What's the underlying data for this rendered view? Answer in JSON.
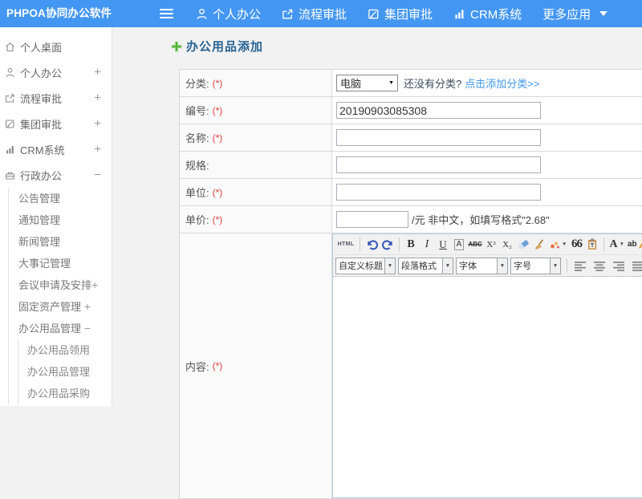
{
  "topbar": {
    "logo": "PHPOA协同办公软件",
    "nav": [
      {
        "label": "个人办公"
      },
      {
        "label": "流程审批"
      },
      {
        "label": "集团审批"
      },
      {
        "label": "CRM系统"
      },
      {
        "label": "更多应用"
      }
    ]
  },
  "sidebar": {
    "items": [
      {
        "label": "个人桌面",
        "expander": ""
      },
      {
        "label": "个人办公",
        "expander": "+"
      },
      {
        "label": "流程审批",
        "expander": "+"
      },
      {
        "label": "集团审批",
        "expander": "+"
      },
      {
        "label": "CRM系统",
        "expander": "+"
      },
      {
        "label": "行政办公",
        "expander": "−"
      }
    ],
    "admin_children": [
      {
        "label": "公告管理",
        "expander": ""
      },
      {
        "label": "通知管理",
        "expander": ""
      },
      {
        "label": "新闻管理",
        "expander": ""
      },
      {
        "label": "大事记管理",
        "expander": ""
      },
      {
        "label": "会议申请及安排",
        "expander": "+"
      },
      {
        "label": "固定资产管理",
        "expander": " +"
      },
      {
        "label": "办公用品管理",
        "expander": " −"
      }
    ],
    "supplies_children": [
      {
        "label": "办公用品领用"
      },
      {
        "label": "办公用品管理"
      },
      {
        "label": "办公用品采购"
      }
    ]
  },
  "main": {
    "title": "办公用品添加",
    "required_mark": "(*)"
  },
  "form": {
    "category": {
      "label": "分类:",
      "selected": "电脑",
      "hint": "还没有分类?",
      "link": "点击添加分类>>"
    },
    "code": {
      "label": "编号:",
      "value": "20190903085308"
    },
    "name": {
      "label": "名称:",
      "value": ""
    },
    "spec": {
      "label": "规格:",
      "value": ""
    },
    "unit": {
      "label": "单位:",
      "value": ""
    },
    "price": {
      "label": "单价:",
      "value": "",
      "suffix": "/元 非中文，如填写格式\"2.68\""
    },
    "content": {
      "label": "内容:"
    }
  },
  "editor": {
    "html_button": "HTML",
    "bold": "B",
    "italic": "I",
    "underline": "U",
    "abox": "A",
    "strike": "ABC",
    "sup": "X²",
    "sub": "X₂",
    "quote": "66",
    "fontcolor": "A",
    "highlight": "ab",
    "selects": [
      {
        "value": "自定义标题"
      },
      {
        "value": "段落格式"
      },
      {
        "value": "字体"
      },
      {
        "value": "字号"
      }
    ]
  }
}
